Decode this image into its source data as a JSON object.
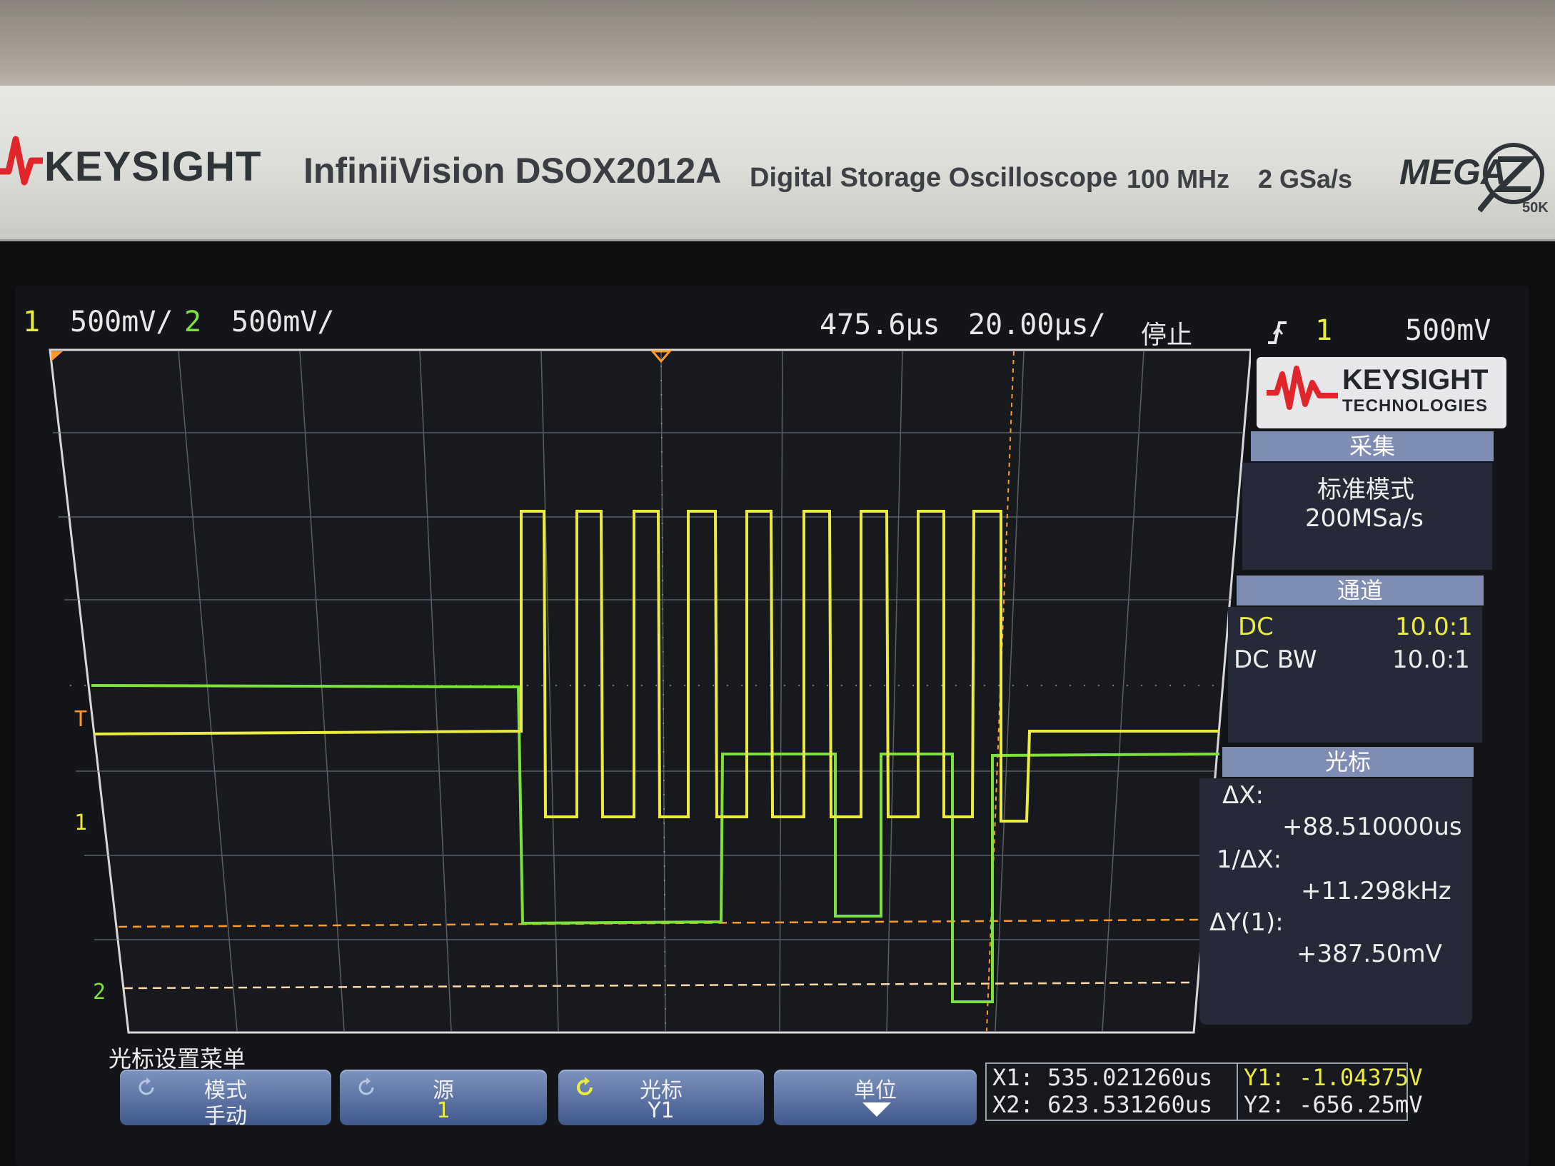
{
  "bezel": {
    "brand": "KEYSIGHT",
    "model": "InfiniiVision DSOX2012A",
    "description": "Digital Storage Oscilloscope",
    "bandwidth": "100 MHz",
    "sample_rate": "2 GSa/s",
    "mega": "MEGA",
    "mega_sub": "50K"
  },
  "status_bar": {
    "ch1_num": "1",
    "ch1_scale": "500mV/",
    "ch2_num": "2",
    "ch2_scale": "500mV/",
    "delay": "475.6µs",
    "timebase": "20.00µs/",
    "run_state": "停止",
    "trigger_source": "1",
    "trigger_level": "500mV"
  },
  "markers": {
    "trigger_T": "T",
    "ch1_ground": "1",
    "ch2_ground": "2"
  },
  "panel": {
    "logo_name": "KEYSIGHT",
    "logo_sub": "TECHNOLOGIES",
    "acq": {
      "header": "采集",
      "mode": "标准模式",
      "rate": "200MSa/s"
    },
    "channel": {
      "header": "通道",
      "row1_left": "DC",
      "row1_right": "10.0:1",
      "row2_left": "DC BW",
      "row2_right": "10.0:1"
    },
    "cursor": {
      "header": "光标",
      "dx_label": "ΔX:",
      "dx_value": "+88.510000us",
      "inv_dx_label": "1/ΔX:",
      "inv_dx_value": "+11.298kHz",
      "dy_label": "ΔY(1):",
      "dy_value": "+387.50mV"
    }
  },
  "softkeys": {
    "menu_title": "光标设置菜单",
    "mode": {
      "label": "模式",
      "value": "手动"
    },
    "source": {
      "label": "源",
      "value": "1"
    },
    "cursor": {
      "label": "光标",
      "value": "Y1"
    },
    "units": {
      "label": "单位"
    }
  },
  "readouts": {
    "x1": "X1: 535.021260us",
    "x2": "X2: 623.531260us",
    "y1": "Y1: -1.04375V",
    "y2": "Y2: -656.25mV"
  },
  "colors": {
    "ch1": "#ecec40",
    "ch2": "#7ce33a",
    "cursor": "#ff9a2a",
    "panel_header": "#7f8cb3"
  }
}
